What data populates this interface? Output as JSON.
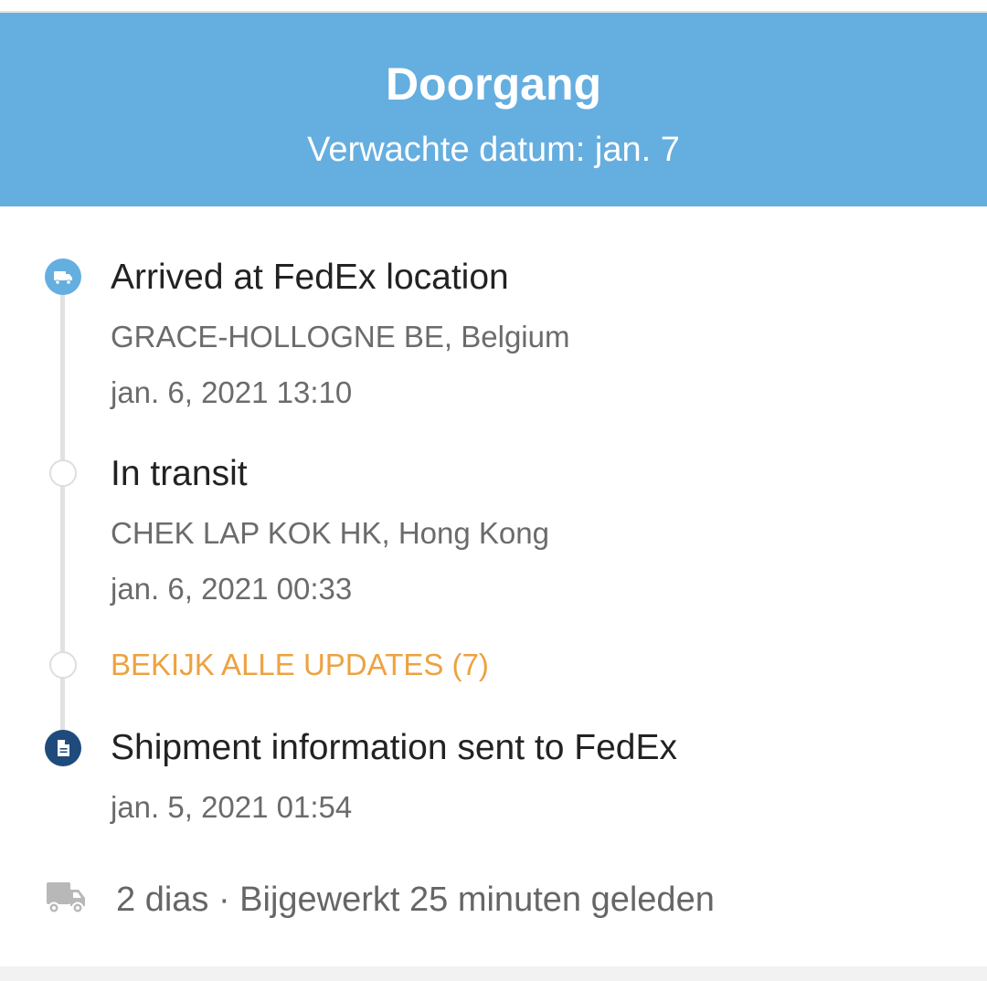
{
  "header": {
    "title": "Doorgang",
    "subtitle": "Verwachte datum: jan. 7",
    "color": "#65aee0"
  },
  "timeline": {
    "events": [
      {
        "title": "Arrived at FedEx location",
        "location": "GRACE-HOLLOGNE BE, Belgium",
        "datetime": "jan. 6, 2021 13:10",
        "icon": "delivery-truck-icon"
      },
      {
        "title": "In transit",
        "location": "CHEK LAP KOK HK, Hong Kong",
        "datetime": "jan. 6, 2021 00:33",
        "icon": "empty-circle"
      },
      {
        "title": "Shipment information sent to FedEx",
        "datetime": "jan. 5, 2021 01:54",
        "icon": "document-icon"
      }
    ],
    "view_all_label": "BEKIJK ALLE UPDATES (7)",
    "view_all_color": "#eda240"
  },
  "footer": {
    "text": "2 dias · Bijgewerkt 25 minuten geleden",
    "icon": "truck-outline-icon"
  }
}
